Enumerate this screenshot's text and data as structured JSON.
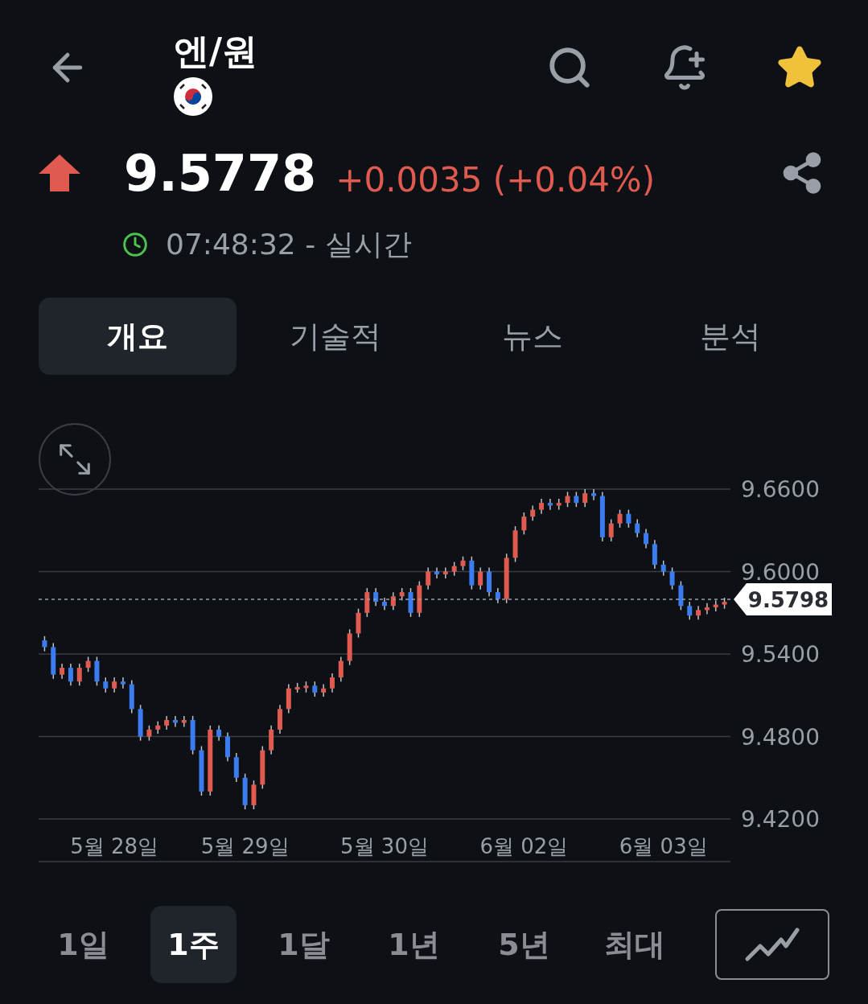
{
  "header": {
    "title": "엔/원",
    "starred": true
  },
  "quote": {
    "price": "9.5778",
    "change": "+0.0035 (+0.04%)",
    "time": "07:48:32 - 실시간"
  },
  "tabs": [
    {
      "label": "개요",
      "selected": true
    },
    {
      "label": "기술적",
      "selected": false
    },
    {
      "label": "뉴스",
      "selected": false
    },
    {
      "label": "분석",
      "selected": false
    }
  ],
  "chart": {
    "chart_data": {
      "type": "candlestick",
      "ylim": [
        9.42,
        9.66
      ],
      "grid": true,
      "ref_lines": [
        {
          "axis": "y",
          "value": 9.5798,
          "label": "9.5798"
        }
      ],
      "categories": [
        null,
        null,
        null,
        null,
        null,
        null,
        null,
        null,
        "5월 28일",
        null,
        null,
        null,
        null,
        null,
        null,
        null,
        null,
        null,
        null,
        null,
        null,
        null,
        null,
        "5월 29일",
        null,
        null,
        null,
        null,
        null,
        null,
        null,
        null,
        null,
        null,
        null,
        null,
        null,
        null,
        null,
        "5월 30일",
        null,
        null,
        null,
        null,
        null,
        null,
        null,
        null,
        null,
        null,
        null,
        null,
        null,
        null,
        null,
        "6월 02일",
        null,
        null,
        null,
        null,
        null,
        null,
        null,
        null,
        null,
        null,
        null,
        null,
        null,
        null,
        null,
        "6월 03일",
        null,
        null,
        null,
        null,
        null,
        null,
        null
      ],
      "yticks": [
        {
          "value": 9.42,
          "label": "9.4200"
        },
        {
          "value": 9.48,
          "label": "9.4800"
        },
        {
          "value": 9.54,
          "label": "9.5400"
        },
        {
          "value": 9.6,
          "label": "9.6000"
        },
        {
          "value": 9.66,
          "label": "9.6600"
        }
      ],
      "ohlc": [
        [
          9.55,
          9.553,
          9.542,
          9.545
        ],
        [
          9.545,
          9.548,
          9.522,
          9.525
        ],
        [
          9.525,
          9.533,
          9.522,
          9.53
        ],
        [
          9.53,
          9.533,
          9.517,
          9.52
        ],
        [
          9.52,
          9.533,
          9.517,
          9.53
        ],
        [
          9.53,
          9.538,
          9.527,
          9.535
        ],
        [
          9.535,
          9.538,
          9.517,
          9.52
        ],
        [
          9.52,
          9.523,
          9.512,
          9.515
        ],
        [
          9.515,
          9.523,
          9.512,
          9.52
        ],
        [
          9.52,
          9.523,
          9.515,
          9.518
        ],
        [
          9.518,
          9.521,
          9.497,
          9.5
        ],
        [
          9.5,
          9.503,
          9.477,
          9.48
        ],
        [
          9.48,
          9.488,
          9.477,
          9.485
        ],
        [
          9.485,
          9.491,
          9.482,
          9.488
        ],
        [
          9.488,
          9.495,
          9.485,
          9.492
        ],
        [
          9.492,
          9.495,
          9.487,
          9.49
        ],
        [
          9.49,
          9.495,
          9.487,
          9.492
        ],
        [
          9.492,
          9.495,
          9.467,
          9.47
        ],
        [
          9.47,
          9.473,
          9.437,
          9.44
        ],
        [
          9.44,
          9.488,
          9.437,
          9.485
        ],
        [
          9.485,
          9.488,
          9.477,
          9.48
        ],
        [
          9.48,
          9.483,
          9.462,
          9.465
        ],
        [
          9.465,
          9.468,
          9.447,
          9.45
        ],
        [
          9.45,
          9.453,
          9.427,
          9.43
        ],
        [
          9.43,
          9.448,
          9.427,
          9.445
        ],
        [
          9.445,
          9.473,
          9.442,
          9.47
        ],
        [
          9.47,
          9.488,
          9.467,
          9.485
        ],
        [
          9.485,
          9.503,
          9.482,
          9.5
        ],
        [
          9.5,
          9.518,
          9.497,
          9.515
        ],
        [
          9.515,
          9.519,
          9.512,
          9.516
        ],
        [
          9.516,
          9.52,
          9.512,
          9.517
        ],
        [
          9.517,
          9.52,
          9.509,
          9.512
        ],
        [
          9.512,
          9.518,
          9.509,
          9.515
        ],
        [
          9.515,
          9.526,
          9.512,
          9.523
        ],
        [
          9.523,
          9.538,
          9.52,
          9.535
        ],
        [
          9.535,
          9.558,
          9.532,
          9.555
        ],
        [
          9.555,
          9.573,
          9.552,
          9.57
        ],
        [
          9.57,
          9.588,
          9.567,
          9.585
        ],
        [
          9.585,
          9.588,
          9.575,
          9.578
        ],
        [
          9.578,
          9.581,
          9.572,
          9.575
        ],
        [
          9.575,
          9.585,
          9.572,
          9.582
        ],
        [
          9.582,
          9.588,
          9.579,
          9.585
        ],
        [
          9.585,
          9.588,
          9.567,
          9.57
        ],
        [
          9.57,
          9.593,
          9.567,
          9.59
        ],
        [
          9.59,
          9.603,
          9.587,
          9.6
        ],
        [
          9.6,
          9.603,
          9.595,
          9.598
        ],
        [
          9.598,
          9.603,
          9.595,
          9.6
        ],
        [
          9.6,
          9.607,
          9.597,
          9.604
        ],
        [
          9.604,
          9.611,
          9.601,
          9.608
        ],
        [
          9.608,
          9.611,
          9.587,
          9.59
        ],
        [
          9.59,
          9.603,
          9.587,
          9.6
        ],
        [
          9.6,
          9.603,
          9.582,
          9.585
        ],
        [
          9.585,
          9.588,
          9.577,
          9.58
        ],
        [
          9.58,
          9.613,
          9.577,
          9.61
        ],
        [
          9.61,
          9.633,
          9.607,
          9.63
        ],
        [
          9.63,
          9.643,
          9.627,
          9.64
        ],
        [
          9.64,
          9.648,
          9.637,
          9.645
        ],
        [
          9.645,
          9.653,
          9.642,
          9.65
        ],
        [
          9.65,
          9.653,
          9.645,
          9.648
        ],
        [
          9.648,
          9.653,
          9.645,
          9.65
        ],
        [
          9.65,
          9.658,
          9.647,
          9.655
        ],
        [
          9.655,
          9.658,
          9.647,
          9.65
        ],
        [
          9.65,
          9.66,
          9.647,
          9.657
        ],
        [
          9.657,
          9.66,
          9.652,
          9.655
        ],
        [
          9.655,
          9.658,
          9.622,
          9.625
        ],
        [
          9.625,
          9.638,
          9.622,
          9.635
        ],
        [
          9.635,
          9.645,
          9.632,
          9.642
        ],
        [
          9.642,
          9.645,
          9.632,
          9.635
        ],
        [
          9.635,
          9.638,
          9.625,
          9.628
        ],
        [
          9.628,
          9.631,
          9.617,
          9.62
        ],
        [
          9.62,
          9.623,
          9.602,
          9.605
        ],
        [
          9.605,
          9.608,
          9.597,
          9.6
        ],
        [
          9.6,
          9.603,
          9.587,
          9.59
        ],
        [
          9.59,
          9.593,
          9.572,
          9.575
        ],
        [
          9.575,
          9.578,
          9.565,
          9.568
        ],
        [
          9.568,
          9.575,
          9.565,
          9.572
        ],
        [
          9.572,
          9.577,
          9.569,
          9.574
        ],
        [
          9.574,
          9.579,
          9.571,
          9.576
        ],
        [
          9.576,
          9.581,
          9.573,
          9.578
        ]
      ]
    }
  },
  "ranges": [
    {
      "label": "1일",
      "selected": false
    },
    {
      "label": "1주",
      "selected": true
    },
    {
      "label": "1달",
      "selected": false
    },
    {
      "label": "1년",
      "selected": false
    },
    {
      "label": "5년",
      "selected": false
    },
    {
      "label": "최대",
      "selected": false
    }
  ]
}
